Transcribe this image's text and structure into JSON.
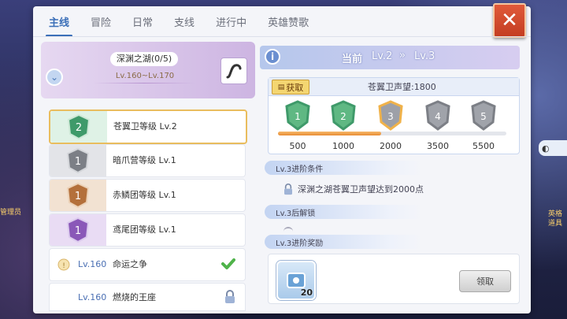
{
  "tabs": [
    "主线",
    "冒险",
    "日常",
    "支线",
    "进行中",
    "英雄赞歌"
  ],
  "close_label": "✕",
  "left_side_label": "管理员",
  "right_side_label1": "英格",
  "right_side_label2": "道具",
  "group": {
    "title": "深渊之湖(0/5)",
    "level_range": "Lv.160~Lv.170"
  },
  "ranks": [
    {
      "num": "2",
      "label": "苍翼卫等级 Lv.2",
      "color": "#3f9a6a",
      "bg": "#dff2e6"
    },
    {
      "num": "1",
      "label": "暗爪营等级 Lv.1",
      "color": "#7c7f86",
      "bg": "#e3e4e8"
    },
    {
      "num": "1",
      "label": "赤鳞团等级 Lv.1",
      "color": "#b4703b",
      "bg": "#f2e2d2"
    },
    {
      "num": "1",
      "label": "鸢尾团等级 Lv.1",
      "color": "#8a58b8",
      "bg": "#e9dcf4"
    }
  ],
  "quests": [
    {
      "level": "Lv.160",
      "name": "命运之争",
      "status": "done"
    },
    {
      "level": "Lv.160",
      "name": "燃烧的王座",
      "status": "locked"
    }
  ],
  "detail": {
    "current_label": "当前",
    "from_level": "Lv.2",
    "to_level": "Lv.3",
    "get_label": "获取",
    "reputation_label": "苍翼卫声望:1800",
    "reputation_value": 1800,
    "milestones": [
      {
        "num": "1",
        "value": "500",
        "state": "done"
      },
      {
        "num": "2",
        "value": "1000",
        "state": "done"
      },
      {
        "num": "3",
        "value": "2000",
        "state": "current"
      },
      {
        "num": "4",
        "value": "3500",
        "state": "locked"
      },
      {
        "num": "5",
        "value": "5500",
        "state": "locked"
      }
    ],
    "sections": {
      "condition": "Lv.3进阶条件",
      "unlock": "Lv.3后解锁",
      "reward": "Lv.3进阶奖励"
    },
    "condition_text": "深渊之湖苍翼卫声望达到2000点",
    "reward_count": "20",
    "claim_label": "领取"
  },
  "colors": {
    "accent": "#3b6fb8",
    "close": "#d24a2c",
    "progress": "#e88c34"
  }
}
